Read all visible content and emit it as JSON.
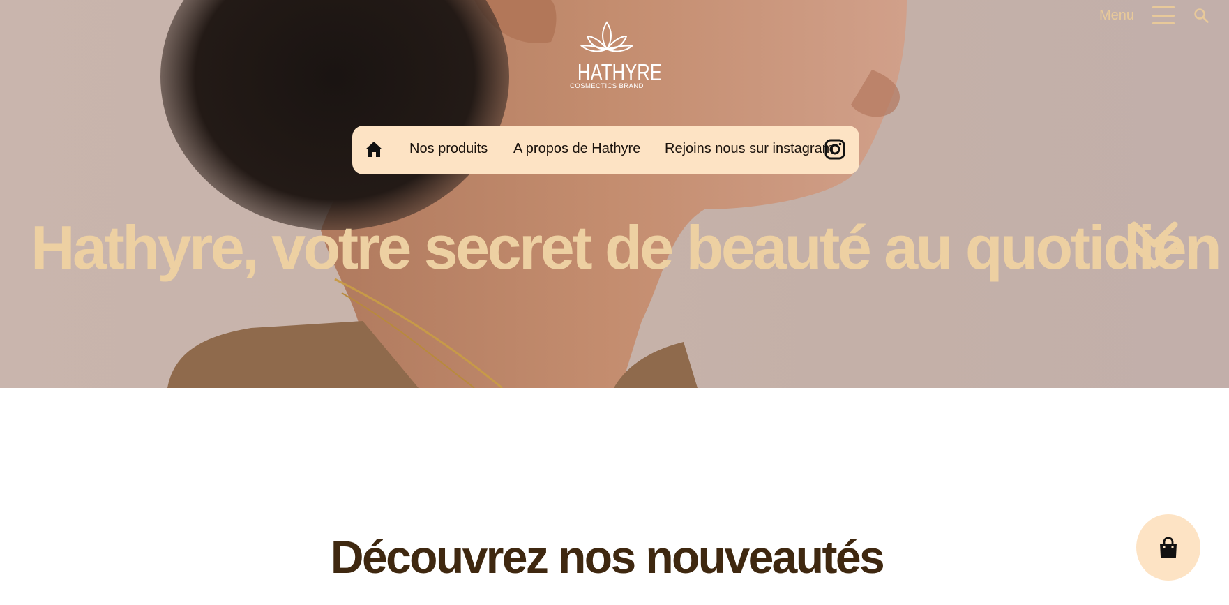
{
  "header": {
    "menu_label": "Menu"
  },
  "logo": {
    "brand": "HATHYRE",
    "tagline": "COSMECTICS BRAND"
  },
  "nav": {
    "items": [
      {
        "label": "Nos produits"
      },
      {
        "label": "A propos de Hathyre"
      },
      {
        "label": "Rejoins nous sur instagram"
      }
    ],
    "icons": [
      "home-icon",
      "instagram-icon"
    ]
  },
  "hero": {
    "title": "Hathyre, votre secret de beauté au quotidien",
    "scroll_icon": "double-chevron-down-icon"
  },
  "main": {
    "section_title": "Découvrez nos nouveautés"
  },
  "cart": {
    "icon": "shopping-bag-icon"
  },
  "colors": {
    "accent_gold": "#edd0a2",
    "nav_bg": "#fde3c4",
    "heading_brown": "#3f2810"
  }
}
